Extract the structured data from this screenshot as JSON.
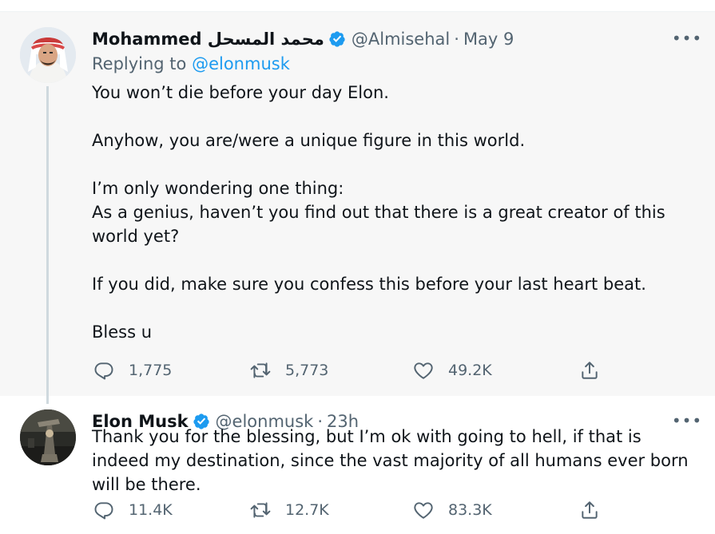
{
  "tweets": [
    {
      "author_name": "Mohammed محمد المسحل",
      "handle": "@Almisehal",
      "separator": "·",
      "time": "May 9",
      "more": "•••",
      "replying_prefix": "Replying to ",
      "replying_to": "@elonmusk",
      "paragraphs": [
        "You won’t die before your day Elon.",
        "Anyhow, you are/were a unique figure in this world.",
        "I’m only wondering one thing:\nAs a genius, haven’t you find out that there is a great creator of this world yet?",
        "If you did, make sure you confess this before your last heart beat.",
        "Bless u"
      ],
      "reply_count": "1,775",
      "retweet_count": "5,773",
      "like_count": "49.2K"
    },
    {
      "author_name": "Elon Musk",
      "handle": "@elonmusk",
      "separator": "·",
      "time": "23h",
      "more": "•••",
      "paragraphs": [
        "Thank you for the blessing, but I’m ok with going to hell, if that is indeed my destination, since the vast majority of all humans ever born will be there."
      ],
      "reply_count": "11.4K",
      "retweet_count": "12.7K",
      "like_count": "83.3K"
    }
  ],
  "icons": {
    "verified": "verified-badge-icon",
    "reply": "reply-icon",
    "retweet": "retweet-icon",
    "like": "heart-icon",
    "share": "share-icon"
  },
  "colors": {
    "accent": "#1d9bf0",
    "secondary_text": "#536471",
    "highlight_bg": "#f7f7f7"
  }
}
